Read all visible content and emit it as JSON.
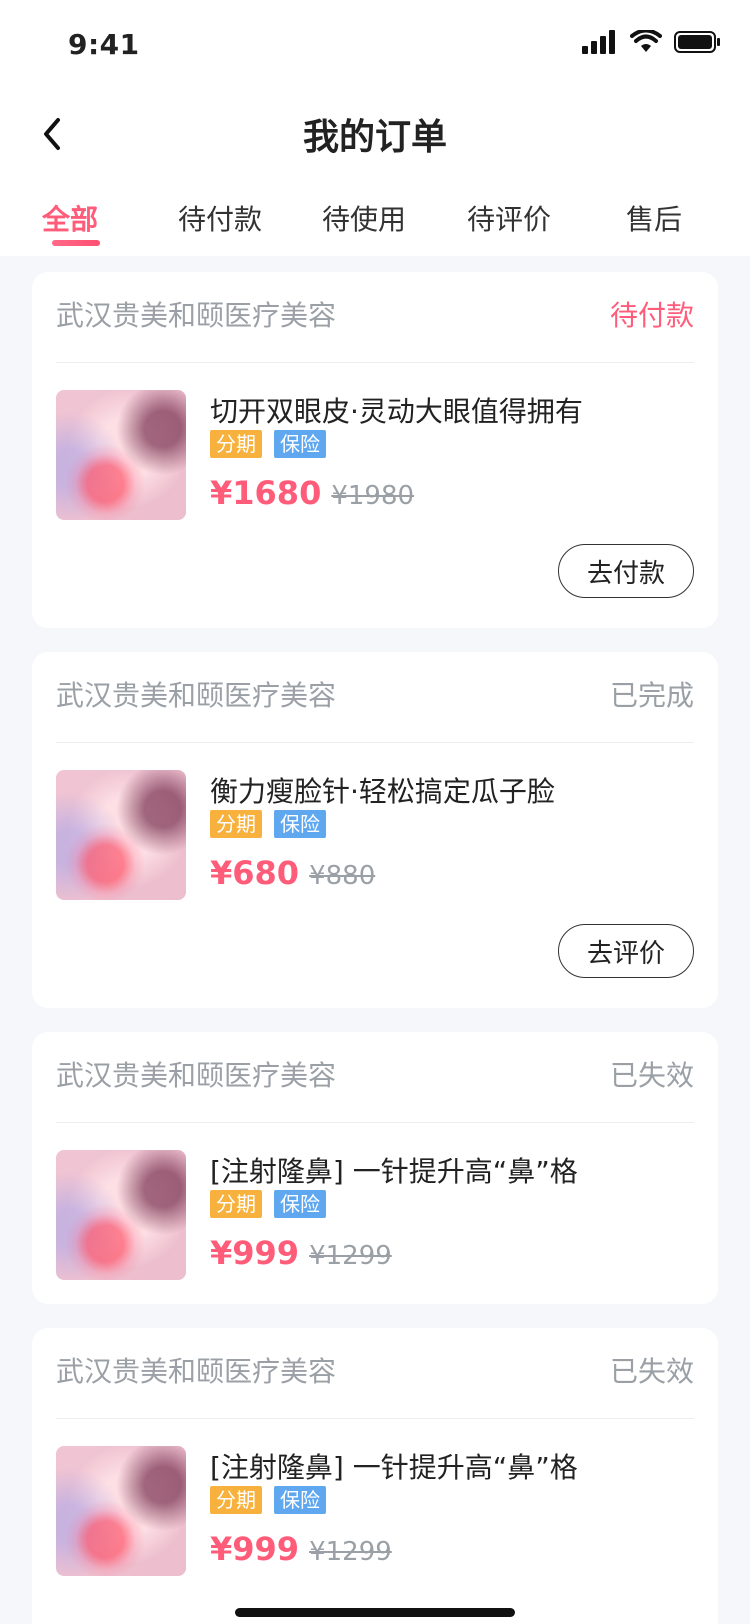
{
  "status_bar": {
    "time": "9:41"
  },
  "nav": {
    "title": "我的订单"
  },
  "tabs": [
    {
      "label": "全部"
    },
    {
      "label": "待付款"
    },
    {
      "label": "待使用"
    },
    {
      "label": "待评价"
    },
    {
      "label": "售后"
    }
  ],
  "orders": [
    {
      "shop": "武汉贵美和颐医疗美容",
      "status": "待付款",
      "status_color": "#ff5c7a",
      "product": "切开双眼皮·灵动大眼值得拥有",
      "tag_installment": "分期",
      "tag_insurance": "保险",
      "price": "¥1680",
      "old_price": "¥1980",
      "action": "去付款"
    },
    {
      "shop": "武汉贵美和颐医疗美容",
      "status": "已完成",
      "status_color": "#9aa0a6",
      "product": "衡力瘦脸针·轻松搞定瓜子脸",
      "tag_installment": "分期",
      "tag_insurance": "保险",
      "price": "¥680",
      "old_price": "¥880",
      "action": "去评价"
    },
    {
      "shop": "武汉贵美和颐医疗美容",
      "status": "已失效",
      "status_color": "#9aa0a6",
      "product": "[注射隆鼻] 一针提升高“鼻”格",
      "tag_installment": "分期",
      "tag_insurance": "保险",
      "price": "¥999",
      "old_price": "¥1299"
    },
    {
      "shop": "武汉贵美和颐医疗美容",
      "status": "已失效",
      "status_color": "#9aa0a6",
      "product": "[注射隆鼻] 一针提升高“鼻”格",
      "tag_installment": "分期",
      "tag_insurance": "保险",
      "price": "¥999",
      "old_price": "¥1299"
    }
  ],
  "colors": {
    "accent": "#ff5c7a",
    "installment": "#f8b13c",
    "insurance": "#5fa8ef"
  }
}
